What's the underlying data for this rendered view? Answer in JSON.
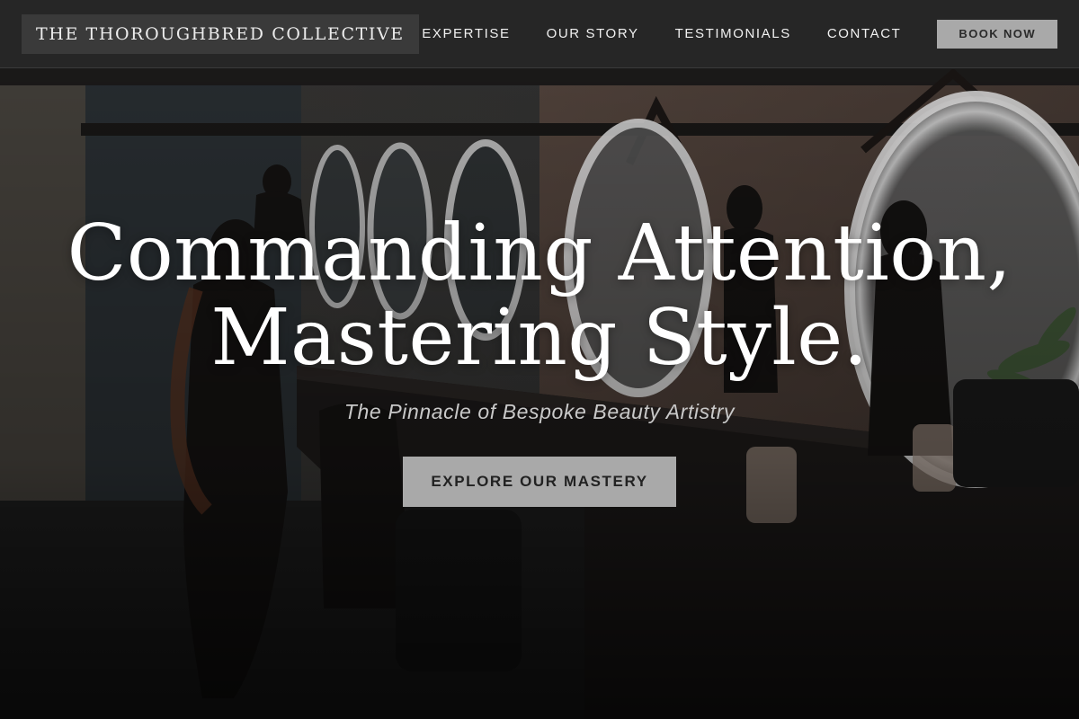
{
  "header": {
    "brand": "THE THOROUGHBRED COLLECTIVE",
    "nav": [
      {
        "label": "EXPERTISE"
      },
      {
        "label": "OUR STORY"
      },
      {
        "label": "TESTIMONIALS"
      },
      {
        "label": "CONTACT"
      }
    ],
    "cta_label": "BOOK NOW"
  },
  "hero": {
    "title_line1": "Commanding Attention,",
    "title_line2": "Mastering Style.",
    "subtitle": "The Pinnacle of Bespoke Beauty Artistry",
    "cta_label": "EXPLORE OUR MASTERY"
  },
  "colors": {
    "header_bg": "#262626",
    "button_bg": "#a9a9a9",
    "text_light": "#ffffff"
  }
}
